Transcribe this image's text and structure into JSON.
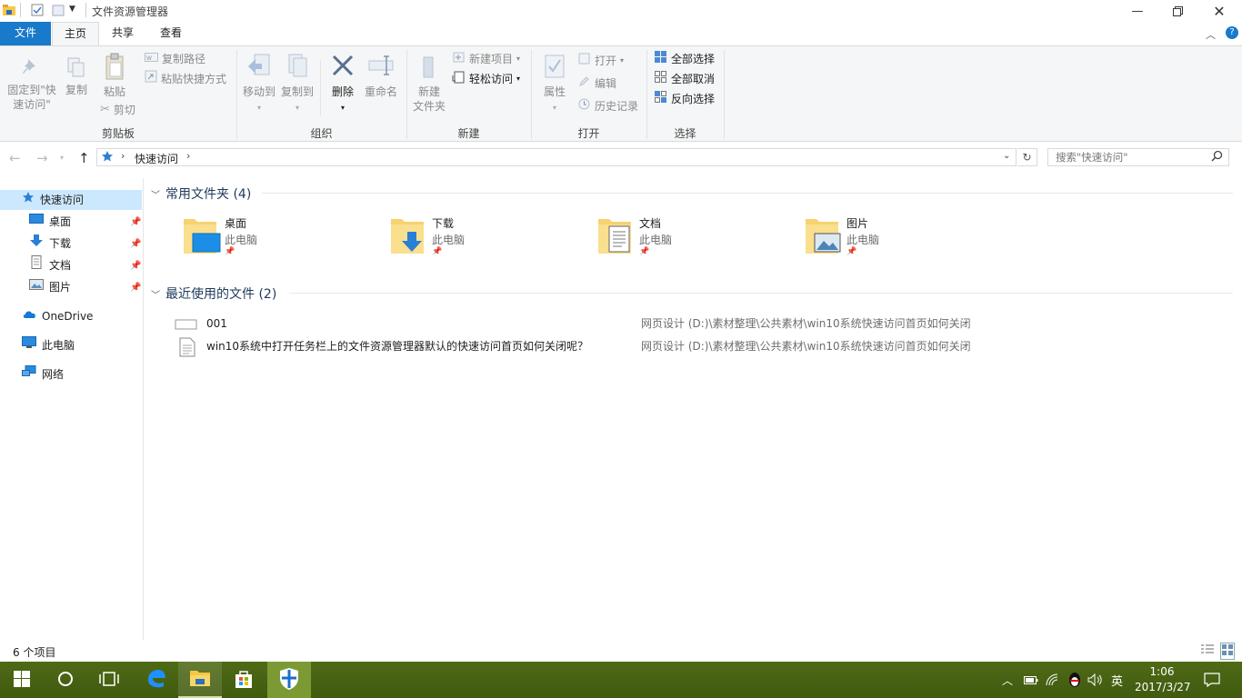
{
  "window": {
    "title": "文件资源管理器"
  },
  "ribbon": {
    "tabs": [
      "文件",
      "主页",
      "共享",
      "查看"
    ],
    "clipboard": {
      "pin_label_1": "固定到\"快",
      "pin_label_2": "速访问\"",
      "copy_label": "复制",
      "paste_label": "粘贴",
      "copy_path_label": "复制路径",
      "paste_shortcut_label": "粘贴快捷方式",
      "cut_label": "剪切",
      "group_label": "剪贴板"
    },
    "organize": {
      "move_to_label": "移动到",
      "copy_to_label": "复制到",
      "delete_label": "删除",
      "rename_label": "重命名",
      "group_label": "组织"
    },
    "new": {
      "new_folder_label_1": "新建",
      "new_folder_label_2": "文件夹",
      "new_item_label": "新建项目",
      "easy_access_label": "轻松访问",
      "group_label": "新建"
    },
    "open": {
      "properties_label": "属性",
      "open_label": "打开",
      "edit_label": "编辑",
      "history_label": "历史记录",
      "group_label": "打开"
    },
    "select": {
      "select_all_label": "全部选择",
      "select_none_label": "全部取消",
      "invert_label": "反向选择",
      "group_label": "选择"
    }
  },
  "address": {
    "location": "快速访问",
    "search_placeholder": "搜索\"快速访问\""
  },
  "navpane": {
    "quick_access": "快速访问",
    "items": [
      {
        "label": "桌面"
      },
      {
        "label": "下载"
      },
      {
        "label": "文档"
      },
      {
        "label": "图片"
      }
    ],
    "onedrive": "OneDrive",
    "this_pc": "此电脑",
    "network": "网络"
  },
  "content": {
    "frequent_header": "常用文件夹 (4)",
    "folders": [
      {
        "name": "桌面",
        "location": "此电脑"
      },
      {
        "name": "下载",
        "location": "此电脑"
      },
      {
        "name": "文档",
        "location": "此电脑"
      },
      {
        "name": "图片",
        "location": "此电脑"
      }
    ],
    "recent_header": "最近使用的文件 (2)",
    "recent_files": [
      {
        "name": "001",
        "path": "网页设计 (D:)\\素材整理\\公共素材\\win10系统快速访问首页如何关闭"
      },
      {
        "name": "win10系统中打开任务栏上的文件资源管理器默认的快速访问首页如何关闭呢？",
        "path": "网页设计 (D:)\\素材整理\\公共素材\\win10系统快速访问首页如何关闭"
      }
    ]
  },
  "status": {
    "item_count": "6 个项目"
  },
  "taskbar": {
    "ime": "英",
    "time": "1:06",
    "date": "2017/3/27"
  },
  "colors": {
    "file_tab": "#1979ca",
    "section_header": "#1e395b",
    "taskbar": "#4a6414",
    "taskbar_active": "#7c9a34"
  }
}
